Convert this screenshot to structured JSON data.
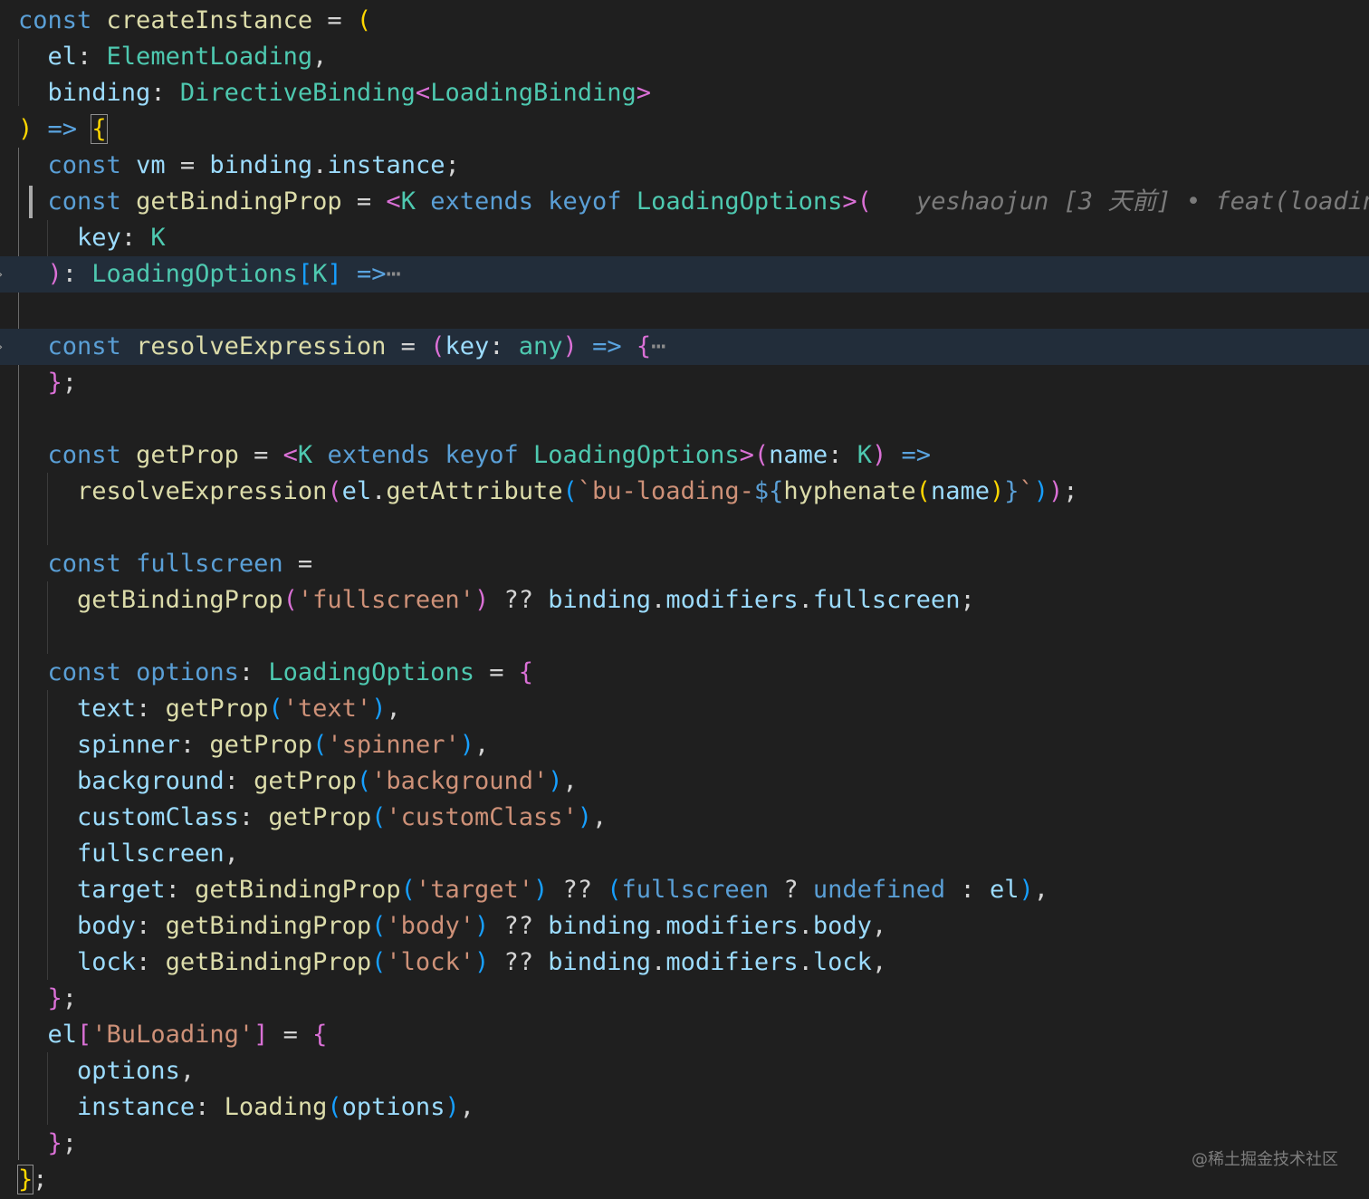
{
  "editor": {
    "blame": "yeshaojun [3 天前] • feat(loadin",
    "watermark": "@稀土掘金技术社区",
    "fold_marker": "⋯",
    "fold_chevron": "›",
    "colors": {
      "background": "#1f1f1f",
      "folded_line_highlight": "#222d3a",
      "keyword": "#5a9fd6",
      "function": "#dcdcaa",
      "type": "#4ec9b0",
      "variable": "#9cdcfe",
      "string": "#ce9178",
      "bracket_level1": "#ffd700",
      "bracket_level2": "#da70d6",
      "bracket_level3": "#179fff"
    }
  },
  "lines": [
    [
      [
        "kw",
        "const"
      ],
      [
        "pl",
        " "
      ],
      [
        "fn",
        "createInstance"
      ],
      [
        "pl",
        " = "
      ],
      [
        "b1",
        "("
      ]
    ],
    [
      [
        "pl",
        "  "
      ],
      [
        "vr",
        "el"
      ],
      [
        "pl",
        ": "
      ],
      [
        "ty",
        "ElementLoading"
      ],
      [
        "pl",
        ","
      ]
    ],
    [
      [
        "pl",
        "  "
      ],
      [
        "vr",
        "binding"
      ],
      [
        "pl",
        ": "
      ],
      [
        "ty",
        "DirectiveBinding"
      ],
      [
        "b2",
        "<"
      ],
      [
        "ty",
        "LoadingBinding"
      ],
      [
        "b2",
        ">"
      ]
    ],
    [
      [
        "b1",
        ")"
      ],
      [
        "pl",
        " "
      ],
      [
        "op",
        "=>"
      ],
      [
        "pl",
        " "
      ],
      [
        "b1",
        "{"
      ]
    ],
    [
      [
        "pl",
        "  "
      ],
      [
        "kw",
        "const"
      ],
      [
        "pl",
        " "
      ],
      [
        "vr",
        "vm"
      ],
      [
        "pl",
        " = "
      ],
      [
        "vr",
        "binding"
      ],
      [
        "pl",
        "."
      ],
      [
        "vr",
        "instance"
      ],
      [
        "pl",
        ";"
      ]
    ],
    [
      [
        "pl",
        "  "
      ],
      [
        "kw",
        "const"
      ],
      [
        "pl",
        " "
      ],
      [
        "fn",
        "getBindingProp"
      ],
      [
        "pl",
        " = "
      ],
      [
        "b2",
        "<"
      ],
      [
        "ty",
        "K"
      ],
      [
        "pl",
        " "
      ],
      [
        "kw",
        "extends"
      ],
      [
        "pl",
        " "
      ],
      [
        "kw",
        "keyof"
      ],
      [
        "pl",
        " "
      ],
      [
        "ty",
        "LoadingOptions"
      ],
      [
        "b2",
        ">"
      ],
      [
        "b2",
        "("
      ]
    ],
    [
      [
        "pl",
        "    "
      ],
      [
        "vr",
        "key"
      ],
      [
        "pl",
        ": "
      ],
      [
        "ty",
        "K"
      ]
    ],
    [
      [
        "pl",
        "  "
      ],
      [
        "b2",
        ")"
      ],
      [
        "pl",
        ": "
      ],
      [
        "ty",
        "LoadingOptions"
      ],
      [
        "b3",
        "["
      ],
      [
        "ty",
        "K"
      ],
      [
        "b3",
        "]"
      ],
      [
        "pl",
        " "
      ],
      [
        "op",
        "=>"
      ],
      [
        "dim",
        "⋯"
      ]
    ],
    [],
    [
      [
        "pl",
        "  "
      ],
      [
        "kw",
        "const"
      ],
      [
        "pl",
        " "
      ],
      [
        "fn",
        "resolveExpression"
      ],
      [
        "pl",
        " = "
      ],
      [
        "b2",
        "("
      ],
      [
        "vr",
        "key"
      ],
      [
        "pl",
        ": "
      ],
      [
        "ty",
        "any"
      ],
      [
        "b2",
        ")"
      ],
      [
        "pl",
        " "
      ],
      [
        "op",
        "=>"
      ],
      [
        "pl",
        " "
      ],
      [
        "b2",
        "{"
      ],
      [
        "dim",
        "⋯"
      ]
    ],
    [
      [
        "pl",
        "  "
      ],
      [
        "b2",
        "}"
      ],
      [
        "pl",
        ";"
      ]
    ],
    [],
    [
      [
        "pl",
        "  "
      ],
      [
        "kw",
        "const"
      ],
      [
        "pl",
        " "
      ],
      [
        "fn",
        "getProp"
      ],
      [
        "pl",
        " = "
      ],
      [
        "b2",
        "<"
      ],
      [
        "ty",
        "K"
      ],
      [
        "pl",
        " "
      ],
      [
        "kw",
        "extends"
      ],
      [
        "pl",
        " "
      ],
      [
        "kw",
        "keyof"
      ],
      [
        "pl",
        " "
      ],
      [
        "ty",
        "LoadingOptions"
      ],
      [
        "b2",
        ">"
      ],
      [
        "b2",
        "("
      ],
      [
        "vr",
        "name"
      ],
      [
        "pl",
        ": "
      ],
      [
        "ty",
        "K"
      ],
      [
        "b2",
        ")"
      ],
      [
        "pl",
        " "
      ],
      [
        "op",
        "=>"
      ]
    ],
    [
      [
        "pl",
        "    "
      ],
      [
        "fn",
        "resolveExpression"
      ],
      [
        "b2",
        "("
      ],
      [
        "vr",
        "el"
      ],
      [
        "pl",
        "."
      ],
      [
        "fn",
        "getAttribute"
      ],
      [
        "b3",
        "("
      ],
      [
        "st",
        "`bu-loading-"
      ],
      [
        "kw",
        "${"
      ],
      [
        "fn",
        "hyphenate"
      ],
      [
        "b1",
        "("
      ],
      [
        "vr",
        "name"
      ],
      [
        "b1",
        ")"
      ],
      [
        "kw",
        "}"
      ],
      [
        "st",
        "`"
      ],
      [
        "b3",
        ")"
      ],
      [
        "b2",
        ")"
      ],
      [
        "pl",
        ";"
      ]
    ],
    [],
    [
      [
        "pl",
        "  "
      ],
      [
        "kw",
        "const"
      ],
      [
        "pl",
        " "
      ],
      [
        "kw",
        "fullscreen"
      ],
      [
        "pl",
        " ="
      ]
    ],
    [
      [
        "pl",
        "    "
      ],
      [
        "fn",
        "getBindingProp"
      ],
      [
        "b2",
        "("
      ],
      [
        "st",
        "'fullscreen'"
      ],
      [
        "b2",
        ")"
      ],
      [
        "pl",
        " ?? "
      ],
      [
        "vr",
        "binding"
      ],
      [
        "pl",
        "."
      ],
      [
        "vr",
        "modifiers"
      ],
      [
        "pl",
        "."
      ],
      [
        "vr",
        "fullscreen"
      ],
      [
        "pl",
        ";"
      ]
    ],
    [],
    [
      [
        "pl",
        "  "
      ],
      [
        "kw",
        "const"
      ],
      [
        "pl",
        " "
      ],
      [
        "kw",
        "options"
      ],
      [
        "pl",
        ": "
      ],
      [
        "ty",
        "LoadingOptions"
      ],
      [
        "pl",
        " = "
      ],
      [
        "b2",
        "{"
      ]
    ],
    [
      [
        "pl",
        "    "
      ],
      [
        "vr",
        "text"
      ],
      [
        "pl",
        ": "
      ],
      [
        "fn",
        "getProp"
      ],
      [
        "b3",
        "("
      ],
      [
        "st",
        "'text'"
      ],
      [
        "b3",
        ")"
      ],
      [
        "pl",
        ","
      ]
    ],
    [
      [
        "pl",
        "    "
      ],
      [
        "vr",
        "spinner"
      ],
      [
        "pl",
        ": "
      ],
      [
        "fn",
        "getProp"
      ],
      [
        "b3",
        "("
      ],
      [
        "st",
        "'spinner'"
      ],
      [
        "b3",
        ")"
      ],
      [
        "pl",
        ","
      ]
    ],
    [
      [
        "pl",
        "    "
      ],
      [
        "vr",
        "background"
      ],
      [
        "pl",
        ": "
      ],
      [
        "fn",
        "getProp"
      ],
      [
        "b3",
        "("
      ],
      [
        "st",
        "'background'"
      ],
      [
        "b3",
        ")"
      ],
      [
        "pl",
        ","
      ]
    ],
    [
      [
        "pl",
        "    "
      ],
      [
        "vr",
        "customClass"
      ],
      [
        "pl",
        ": "
      ],
      [
        "fn",
        "getProp"
      ],
      [
        "b3",
        "("
      ],
      [
        "st",
        "'customClass'"
      ],
      [
        "b3",
        ")"
      ],
      [
        "pl",
        ","
      ]
    ],
    [
      [
        "pl",
        "    "
      ],
      [
        "vr",
        "fullscreen"
      ],
      [
        "pl",
        ","
      ]
    ],
    [
      [
        "pl",
        "    "
      ],
      [
        "vr",
        "target"
      ],
      [
        "pl",
        ": "
      ],
      [
        "fn",
        "getBindingProp"
      ],
      [
        "b3",
        "("
      ],
      [
        "st",
        "'target'"
      ],
      [
        "b3",
        ")"
      ],
      [
        "pl",
        " ?? "
      ],
      [
        "b3",
        "("
      ],
      [
        "kw",
        "fullscreen"
      ],
      [
        "pl",
        " ? "
      ],
      [
        "kw",
        "undefined"
      ],
      [
        "pl",
        " : "
      ],
      [
        "vr",
        "el"
      ],
      [
        "b3",
        ")"
      ],
      [
        "pl",
        ","
      ]
    ],
    [
      [
        "pl",
        "    "
      ],
      [
        "vr",
        "body"
      ],
      [
        "pl",
        ": "
      ],
      [
        "fn",
        "getBindingProp"
      ],
      [
        "b3",
        "("
      ],
      [
        "st",
        "'body'"
      ],
      [
        "b3",
        ")"
      ],
      [
        "pl",
        " ?? "
      ],
      [
        "vr",
        "binding"
      ],
      [
        "pl",
        "."
      ],
      [
        "vr",
        "modifiers"
      ],
      [
        "pl",
        "."
      ],
      [
        "vr",
        "body"
      ],
      [
        "pl",
        ","
      ]
    ],
    [
      [
        "pl",
        "    "
      ],
      [
        "vr",
        "lock"
      ],
      [
        "pl",
        ": "
      ],
      [
        "fn",
        "getBindingProp"
      ],
      [
        "b3",
        "("
      ],
      [
        "st",
        "'lock'"
      ],
      [
        "b3",
        ")"
      ],
      [
        "pl",
        " ?? "
      ],
      [
        "vr",
        "binding"
      ],
      [
        "pl",
        "."
      ],
      [
        "vr",
        "modifiers"
      ],
      [
        "pl",
        "."
      ],
      [
        "vr",
        "lock"
      ],
      [
        "pl",
        ","
      ]
    ],
    [
      [
        "pl",
        "  "
      ],
      [
        "b2",
        "}"
      ],
      [
        "pl",
        ";"
      ]
    ],
    [
      [
        "pl",
        "  "
      ],
      [
        "vr",
        "el"
      ],
      [
        "b2",
        "["
      ],
      [
        "st",
        "'BuLoading'"
      ],
      [
        "b2",
        "]"
      ],
      [
        "pl",
        " = "
      ],
      [
        "b2",
        "{"
      ]
    ],
    [
      [
        "pl",
        "    "
      ],
      [
        "vr",
        "options"
      ],
      [
        "pl",
        ","
      ]
    ],
    [
      [
        "pl",
        "    "
      ],
      [
        "vr",
        "instance"
      ],
      [
        "pl",
        ": "
      ],
      [
        "fn",
        "Loading"
      ],
      [
        "b3",
        "("
      ],
      [
        "vr",
        "options"
      ],
      [
        "b3",
        ")"
      ],
      [
        "pl",
        ","
      ]
    ],
    [
      [
        "pl",
        "  "
      ],
      [
        "b2",
        "}"
      ],
      [
        "pl",
        ";"
      ]
    ],
    [
      [
        "b1",
        "}"
      ],
      [
        "pl",
        ";"
      ]
    ]
  ]
}
